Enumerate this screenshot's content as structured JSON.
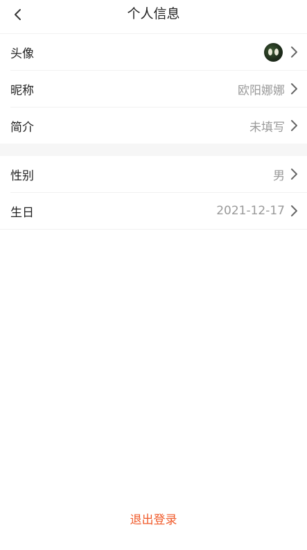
{
  "nav": {
    "title": "个人信息",
    "back_icon": "chevron-left-icon"
  },
  "profile": {
    "avatar": {
      "label": "头像",
      "icon": "avatar-image"
    },
    "nickname": {
      "label": "昵称",
      "value": "欧阳娜娜"
    },
    "bio": {
      "label": "简介",
      "value": "未填写"
    },
    "gender": {
      "label": "性别",
      "value": "男"
    },
    "birthday": {
      "label": "生日",
      "value": "2021-12-17"
    }
  },
  "actions": {
    "logout": "退出登录"
  },
  "colors": {
    "accent": "#f05a2a",
    "value_text": "#999999",
    "divider": "#f1f1f1"
  }
}
